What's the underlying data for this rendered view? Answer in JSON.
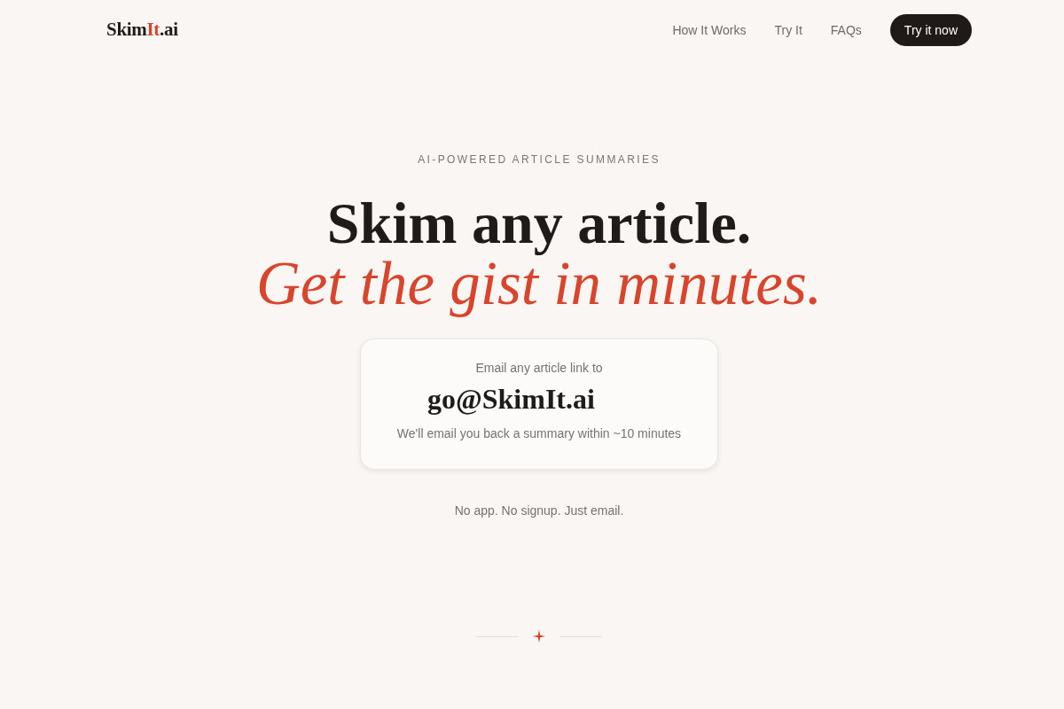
{
  "header": {
    "logo": [
      {
        "text": "Skim",
        "accent": false
      },
      {
        "text": "It",
        "accent": true
      },
      {
        "text": ".ai",
        "accent": false
      }
    ],
    "nav_links": [
      "How It Works",
      "Try It",
      "FAQs"
    ],
    "cta_button": "Try it now"
  },
  "hero": {
    "eyebrow": "AI-POWERED ARTICLE SUMMARIES",
    "headline": "Skim any article.",
    "headline_accent": "Get the gist in minutes.",
    "card": {
      "label": "Email any article link to",
      "email": "go@SkimIt.ai",
      "note": "We'll email you back a summary within ~10 minutes"
    },
    "tagline": "No app. No signup. Just email."
  }
}
